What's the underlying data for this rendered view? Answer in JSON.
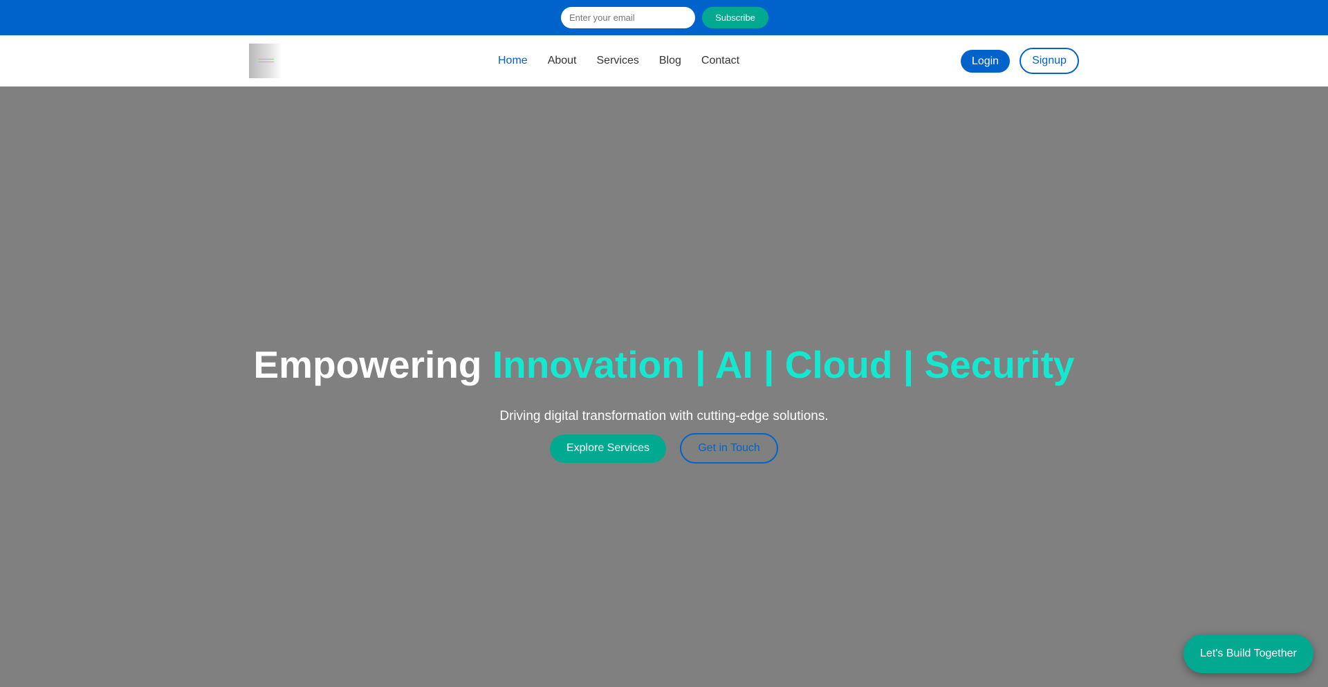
{
  "topbar": {
    "email_placeholder": "Enter your email",
    "subscribe_label": "Subscribe"
  },
  "nav": {
    "links": [
      "Home",
      "About",
      "Services",
      "Blog",
      "Contact"
    ],
    "active": "Home",
    "login_label": "Login",
    "signup_label": "Signup"
  },
  "hero": {
    "title_lead": "Empowering",
    "title_accent": "Innovation | AI | Cloud | Security",
    "subtitle": "Driving digital transformation with cutting-edge solutions.",
    "primary_cta": "Explore Services",
    "secondary_cta": "Get in Touch"
  },
  "floating_cta": "Let's Build Together",
  "colors": {
    "brand_blue": "#0063cc",
    "teal": "#00a98f",
    "accent_cyan": "#14e8d0",
    "hero_bg": "#808080"
  }
}
